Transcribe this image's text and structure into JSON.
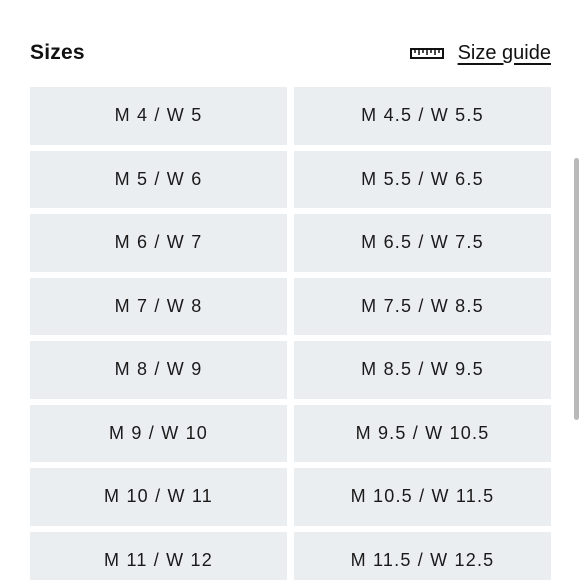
{
  "header": {
    "title": "Sizes",
    "size_guide_label": "Size guide",
    "size_guide_icon": "ruler-icon"
  },
  "sizes": [
    "M 4 / W 5",
    "M 4.5 / W 5.5",
    "M 5 / W 6",
    "M 5.5 / W 6.5",
    "M 6 / W 7",
    "M 6.5 / W 7.5",
    "M 7 / W 8",
    "M 7.5 / W 8.5",
    "M 8 / W 9",
    "M 8.5 / W 9.5",
    "M 9 / W 10",
    "M 9.5 / W 10.5",
    "M 10 / W 11",
    "M 10.5 / W 11.5",
    "M 11 / W 12",
    "M 11.5 / W 12.5"
  ],
  "colors": {
    "tile_background": "#ebeef1",
    "text": "#111111",
    "scrollbar": "#b9b9b9"
  }
}
